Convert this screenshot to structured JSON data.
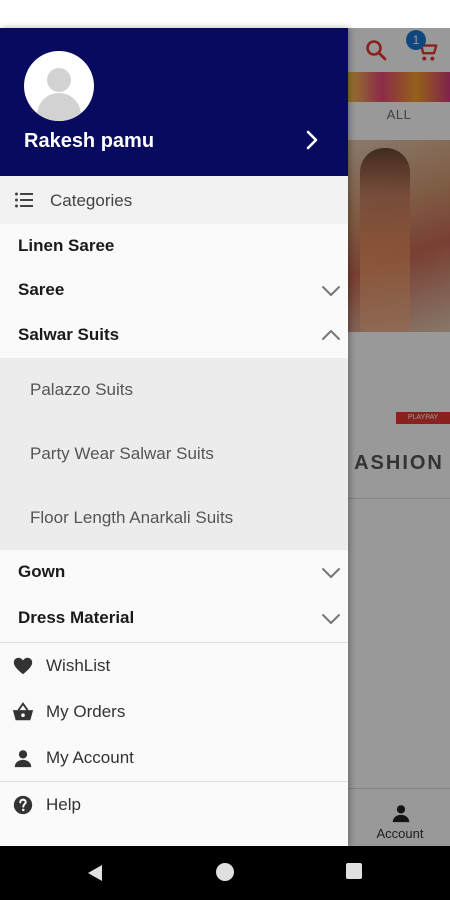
{
  "background": {
    "tab_all": "ALL",
    "cart_badge": "1",
    "banner_tag": "PLAYPAY",
    "fashion_text": "ASHION",
    "bottom_nav_account": "Account"
  },
  "drawer": {
    "header": {
      "user_name": "Rakesh pamu",
      "bg_color": "#070a5e"
    },
    "categories_label": "Categories",
    "categories": [
      {
        "label": "Linen Saree",
        "expandable": false
      },
      {
        "label": "Saree",
        "expandable": true,
        "expanded": false
      },
      {
        "label": "Salwar Suits",
        "expandable": true,
        "expanded": true,
        "subcategories": [
          "Palazzo Suits",
          "Party Wear Salwar Suits",
          "Floor Length Anarkali Suits"
        ]
      },
      {
        "label": "Gown",
        "expandable": true,
        "expanded": false
      },
      {
        "label": "Dress Material",
        "expandable": true,
        "expanded": false
      }
    ],
    "menu": [
      {
        "label": "WishList",
        "icon": "heart-icon"
      },
      {
        "label": "My Orders",
        "icon": "basket-icon"
      },
      {
        "label": "My Account",
        "icon": "person-icon"
      }
    ],
    "help": {
      "label": "Help",
      "icon": "help-circle-icon"
    }
  },
  "colors": {
    "accent_red": "#e53935",
    "badge_blue": "#1976d2"
  }
}
